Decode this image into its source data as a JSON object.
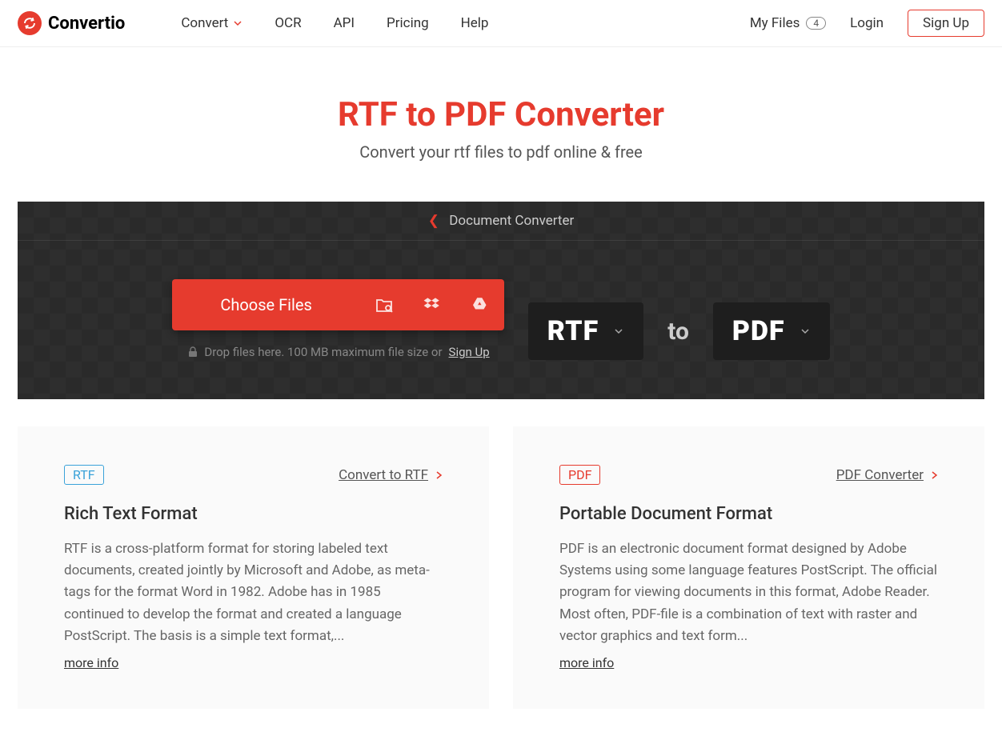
{
  "brand": "Convertio",
  "nav": {
    "convert": "Convert",
    "ocr": "OCR",
    "api": "API",
    "pricing": "Pricing",
    "help": "Help"
  },
  "right": {
    "myfiles": "My Files",
    "badge": "4",
    "login": "Login",
    "signup": "Sign Up"
  },
  "hero": {
    "title": "RTF to PDF Converter",
    "subtitle": "Convert your rtf files to pdf online & free"
  },
  "breadcrumb": "Document Converter",
  "choose": "Choose Files",
  "hint_prefix": "Drop files here. 100 MB maximum file size or ",
  "hint_link": "Sign Up",
  "from_fmt": "RTF",
  "to_label": "to",
  "to_fmt": "PDF",
  "card_left": {
    "tag": "RTF",
    "link": "Convert to RTF",
    "title": "Rich Text Format",
    "desc": "RTF is a cross-platform format for storing labeled text documents, created jointly by Microsoft and Adobe, as meta-tags for the format Word in 1982. Adobe has in 1985 continued to develop the format and created a language PostScript. The basis is a simple text format,...",
    "more": "more info"
  },
  "card_right": {
    "tag": "PDF",
    "link": "PDF Converter",
    "title": "Portable Document Format",
    "desc": "PDF is an electronic document format designed by Adobe Systems using some language features PostScript. The official program for viewing documents in this format, Adobe Reader. Most often, PDF-file is a combination of text with raster and vector graphics and text form...",
    "more": "more info"
  }
}
